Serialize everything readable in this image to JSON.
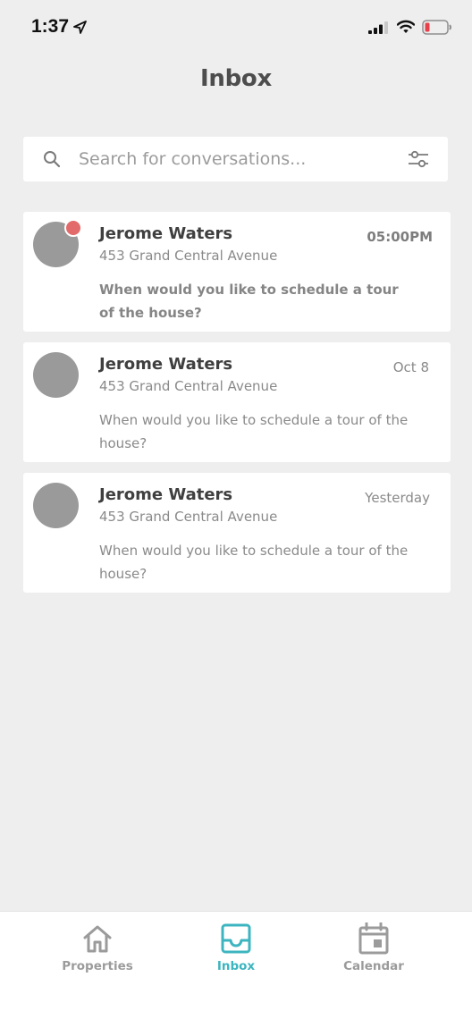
{
  "status_bar": {
    "time": "1:37"
  },
  "header": {
    "title": "Inbox"
  },
  "search": {
    "placeholder": "Search for conversations..."
  },
  "conversations": [
    {
      "name": "Jerome Waters",
      "address": "453 Grand Central Avenue",
      "time": "05:00PM",
      "message": "When would you like to schedule a tour of the house?",
      "unread": true
    },
    {
      "name": "Jerome Waters",
      "address": "453 Grand Central Avenue",
      "time": "Oct 8",
      "message": "When would you like to schedule a tour of the house?",
      "unread": false
    },
    {
      "name": "Jerome Waters",
      "address": "453 Grand Central Avenue",
      "time": "Yesterday",
      "message": "When would you like to schedule a tour of the house?",
      "unread": false
    }
  ],
  "bottom_nav": {
    "items": [
      {
        "label": "Properties",
        "icon": "home-icon",
        "active": false
      },
      {
        "label": "Inbox",
        "icon": "inbox-icon",
        "active": true
      },
      {
        "label": "Calendar",
        "icon": "calendar-icon",
        "active": false
      }
    ]
  },
  "colors": {
    "accent": "#3db5c0",
    "unread_dot": "#e36a6a",
    "background": "#eeeeee",
    "avatar": "#9a9a9a"
  }
}
